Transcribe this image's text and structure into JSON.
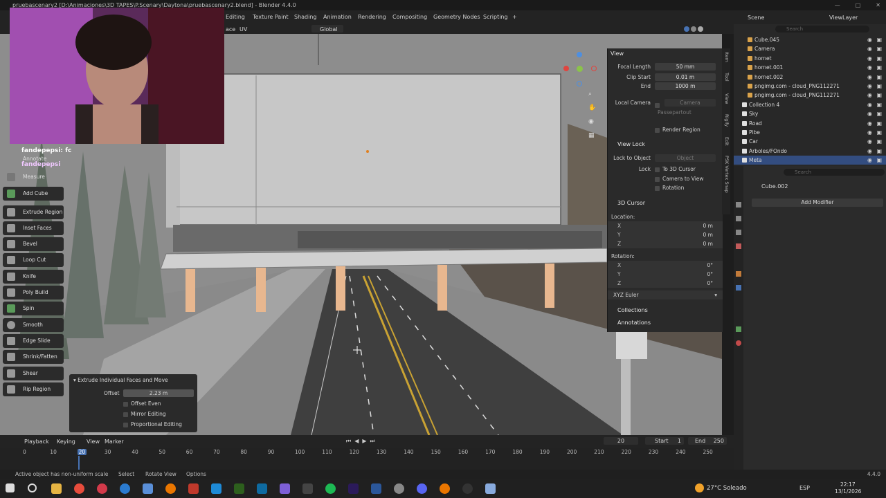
{
  "window": {
    "title": "pruebascenary2 [D:\\Animaciones\\3D TAPES\\P.Scenary\\Daytona\\pruebascenary2.blend] - Blender 4.4.0",
    "controls": [
      "—",
      "□",
      "✕"
    ]
  },
  "menubar": {
    "items": [
      "Editing",
      "Texture Paint",
      "Shading",
      "Animation",
      "Rendering",
      "Compositing",
      "Geometry Nodes",
      "Scripting",
      "+"
    ],
    "scene_label": "Scene",
    "view_layer_label": "ViewLayer"
  },
  "viewport_header": {
    "mode_partial": "ace",
    "uv_label": "UV",
    "transform_orientation": "Global",
    "xyz": [
      "X",
      "Y",
      "Z"
    ],
    "options_label": "Options"
  },
  "npanel": {
    "view_section": "View",
    "focal_length_label": "Focal Length",
    "focal_length": "50 mm",
    "clip_start_label": "Clip Start",
    "clip_start": "0.01 m",
    "end_label": "End",
    "end": "1000 m",
    "local_camera_label": "Local Camera",
    "local_camera_value": "Camera",
    "passepartout_label": "Passepartout",
    "render_region_label": "Render Region",
    "view_lock_section": "View Lock",
    "lock_to_object_label": "Lock to Object",
    "lock_to_object_placeholder": "Object",
    "lock_label": "Lock",
    "to_3d_cursor": "To 3D Cursor",
    "camera_to_view": "Camera to View",
    "rotation_lock": "Rotation",
    "cursor_section": "3D Cursor",
    "location_label": "Location:",
    "loc_x": "0 m",
    "loc_y": "0 m",
    "loc_z": "0 m",
    "rotation_label": "Rotation:",
    "rot_x": "0°",
    "rot_y": "0°",
    "rot_z": "0°",
    "axis_x": "X",
    "axis_y": "Y",
    "axis_z": "Z",
    "rotation_mode": "XYZ Euler",
    "collections_label": "Collections",
    "annotations_label": "Annotations",
    "tabs": [
      "Item",
      "Tool",
      "View",
      "Rigify",
      "Edit",
      "PSK Vertex Snap"
    ]
  },
  "toolbar": {
    "overlay_labels": [
      "fandepepsi: fc",
      "Annotate",
      "fandepepsi"
    ],
    "tools": [
      "Measure",
      "Add Cube",
      "Extrude Region",
      "Inset Faces",
      "Bevel",
      "Loop Cut",
      "Knife",
      "Poly Build",
      "Spin",
      "Smooth",
      "Edge Slide",
      "Shrink/Fatten",
      "Shear",
      "Rip Region"
    ]
  },
  "operator_panel": {
    "title": "Extrude Individual Faces and Move",
    "offset_label": "Offset",
    "offset_value": "2.23 m",
    "options": [
      "Offset Even",
      "Mirror Editing",
      "Proportional Editing"
    ]
  },
  "outliner": {
    "search_placeholder": "Search",
    "items": [
      {
        "name": "Cube.045",
        "kind": "mesh"
      },
      {
        "name": "Camera",
        "kind": "camera"
      },
      {
        "name": "hornet",
        "kind": "object"
      },
      {
        "name": "hornet.001",
        "kind": "object"
      },
      {
        "name": "hornet.002",
        "kind": "object"
      },
      {
        "name": "pngimg.com - cloud_PNG112271",
        "kind": "object"
      },
      {
        "name": "pngimg.com - cloud_PNG112271",
        "kind": "object"
      },
      {
        "name": "Collection 4",
        "kind": "collection"
      },
      {
        "name": "Sky",
        "kind": "collection"
      },
      {
        "name": "Road",
        "kind": "collection"
      },
      {
        "name": "Pibe",
        "kind": "collection"
      },
      {
        "name": "Car",
        "kind": "collection"
      },
      {
        "name": "Arboles/FOndo",
        "kind": "collection"
      },
      {
        "name": "Meta",
        "kind": "collection"
      }
    ]
  },
  "properties": {
    "search_placeholder": "Search",
    "object_name": "Cube.002",
    "add_modifier_label": "Add Modifier"
  },
  "timeline": {
    "menu": [
      "Playback",
      "Keying",
      "View",
      "Marker"
    ],
    "current_frame": "20",
    "start_label": "Start",
    "start": "1",
    "end_label": "End",
    "end": "250",
    "ticks": [
      "0",
      "10",
      "20",
      "30",
      "40",
      "50",
      "60",
      "70",
      "80",
      "90",
      "100",
      "110",
      "120",
      "130",
      "140",
      "150",
      "160",
      "170",
      "180",
      "190",
      "200",
      "210",
      "220",
      "230",
      "240",
      "250"
    ]
  },
  "statusbar": {
    "warning": "Active object has non-uniform scale",
    "hints": [
      "Select",
      "Rotate View",
      "Options"
    ],
    "version": "4.4.0"
  },
  "taskbar": {
    "weather": "27°C Soleado",
    "lang": "ESP",
    "time": "22:17",
    "date": "13/1/2026"
  },
  "colors": {
    "accent_blue": "#4772b3",
    "pillar_orange": "#e8b78f",
    "panel_bg": "#2a2a2a"
  }
}
